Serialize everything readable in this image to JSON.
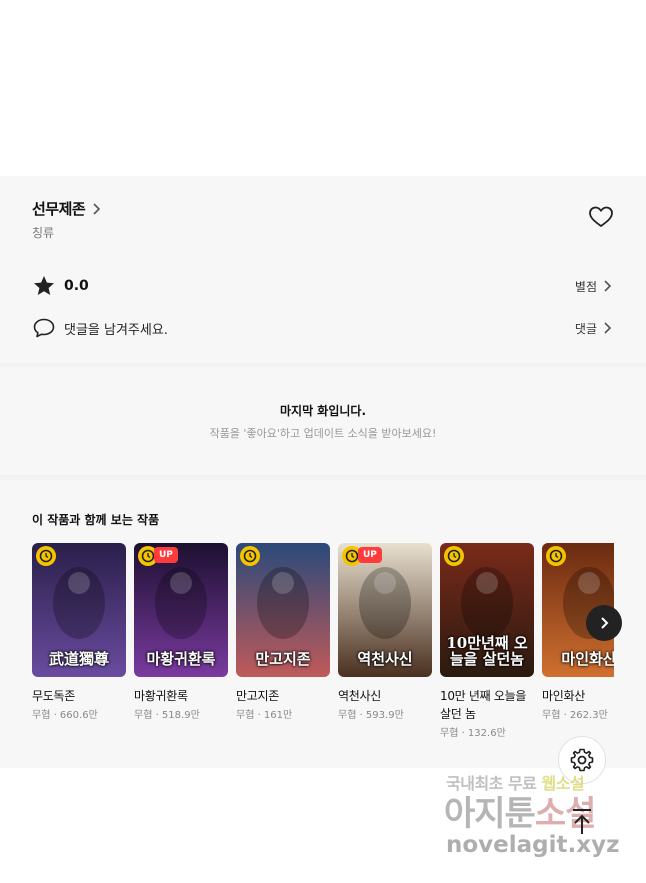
{
  "series": {
    "title": "선무제존",
    "author": "칭류"
  },
  "rating": {
    "value": "0.0",
    "link_label": "별점"
  },
  "comment": {
    "prompt": "댓글을 남겨주세요.",
    "link_label": "댓글"
  },
  "last_episode": {
    "title": "마지막 화입니다.",
    "subtitle": "작품을 '좋아요'하고 업데이트 소식을 받아보세요!"
  },
  "recommendations": {
    "heading": "이 작품과 함께 보는 작품",
    "items": [
      {
        "title": "무도독존",
        "meta": "무협 · 660.6만",
        "cover_text": "武道獨尊",
        "up": false,
        "colors": [
          "#2a1f4a",
          "#6a4ca0"
        ]
      },
      {
        "title": "마황귀환록",
        "meta": "무협 · 518.9만",
        "cover_text": "마황귀환록",
        "up": true,
        "colors": [
          "#1c1030",
          "#7a3aa0"
        ]
      },
      {
        "title": "만고지존",
        "meta": "무협 · 161만",
        "cover_text": "만고지존",
        "up": false,
        "colors": [
          "#2a4a7a",
          "#c05a5a"
        ]
      },
      {
        "title": "역천사신",
        "meta": "무협 · 593.9만",
        "cover_text": "역천사신",
        "up": true,
        "colors": [
          "#e8e0d0",
          "#4a3020"
        ]
      },
      {
        "title": "10만 년째 오늘을 살던 놈",
        "meta": "무협 · 132.6만",
        "cover_text": "10만년째 오늘을 살던놈",
        "up": false,
        "colors": [
          "#7a2a1a",
          "#2a1a10"
        ]
      },
      {
        "title": "마인화산",
        "meta": "무협 · 262.3만",
        "cover_text": "마인화산",
        "up": false,
        "colors": [
          "#6a2a10",
          "#d07030"
        ]
      }
    ]
  },
  "watermark": {
    "line1_a": "국내최초 무료 ",
    "line1_b": "웹소설",
    "line2_a": "아지툰",
    "line2_b": "소설",
    "line3": "novelagit.xyz"
  },
  "colors": {
    "section_bg": "#f7f7f7",
    "up_badge": "#ff3b3b",
    "clock_badge": "#f5c400"
  }
}
